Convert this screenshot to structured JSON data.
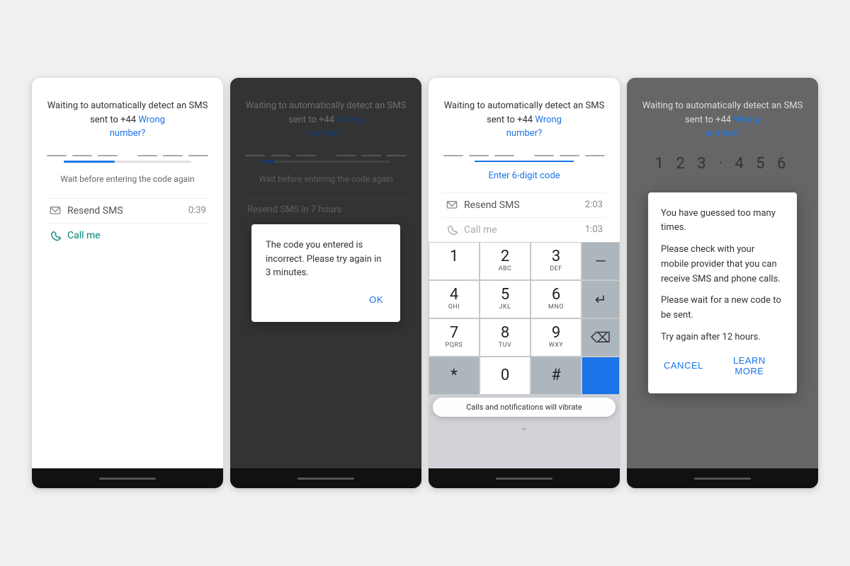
{
  "screen1": {
    "header": "Waiting to automatically detect an SMS sent to +44",
    "wrong": "Wrong",
    "number": "number?",
    "progress": 40,
    "wait_text": "Wait before entering the code again",
    "resend_label": "Resend SMS",
    "resend_timer": "0:39",
    "call_label": "Call me"
  },
  "screen2": {
    "header": "Waiting to automatically detect an SMS sent to +44",
    "wrong": "Wrong",
    "number": "number?",
    "progress": 10,
    "wait_text": "Wait before entering the code again",
    "resend_label": "Resend SMS in 7 hours",
    "dialog_text": "The code you entered is incorrect. Please try again in 3 minutes.",
    "dialog_ok": "OK"
  },
  "screen3": {
    "header": "Waiting to automatically detect an SMS sent to +44",
    "wrong": "Wrong",
    "number": "number?",
    "enter_code": "Enter 6-digit code",
    "resend_label": "Resend SMS",
    "resend_timer": "2:03",
    "call_label": "Call me",
    "call_timer": "1:03",
    "toast": "Calls and notifications will vibrate",
    "keys": [
      {
        "num": "1",
        "letters": ""
      },
      {
        "num": "2",
        "letters": "ABC"
      },
      {
        "num": "3",
        "letters": "DEF"
      },
      {
        "num": "4",
        "letters": "GHI"
      },
      {
        "num": "5",
        "letters": "JKL"
      },
      {
        "num": "6",
        "letters": "MNO"
      },
      {
        "num": "7",
        "letters": "PQRS"
      },
      {
        "num": "8",
        "letters": "TUV"
      },
      {
        "num": "9",
        "letters": "WXY"
      },
      {
        "num": "*",
        "letters": ""
      },
      {
        "num": "0",
        "letters": ""
      },
      {
        "num": "#",
        "letters": ""
      }
    ]
  },
  "screen4": {
    "header": "Waiting to automatically detect an SMS sent to +44",
    "wrong": "Wrong",
    "number": "number?",
    "code_digits": "1 2 3 · 4 5 6",
    "dialog_line1": "You have guessed too many times.",
    "dialog_line2": "Please check with your mobile provider that you can receive SMS and phone calls.",
    "dialog_line3": "Please wait for a new code to be sent.",
    "dialog_line4": "Try again after 12 hours.",
    "cancel_label": "CANCEL",
    "learn_more_label": "LEARN MORE"
  }
}
